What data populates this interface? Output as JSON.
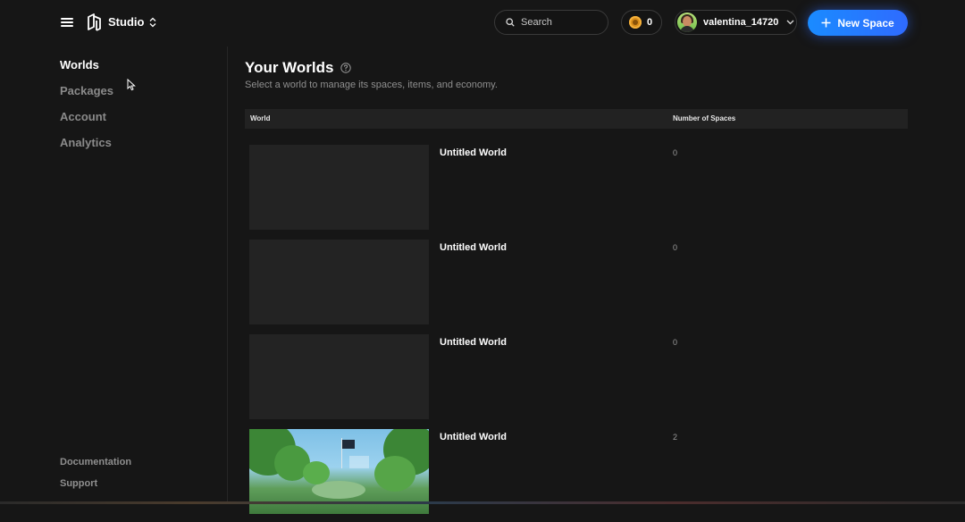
{
  "header": {
    "studio_label": "Studio",
    "search": {
      "placeholder": "Search"
    },
    "coins": "0",
    "username": "valentina_14720",
    "new_space_label": "New Space",
    "accent_color": "#1a8bff"
  },
  "sidebar": {
    "nav": [
      {
        "label": "Worlds",
        "active": true
      },
      {
        "label": "Packages",
        "active": false
      },
      {
        "label": "Account",
        "active": false
      },
      {
        "label": "Analytics",
        "active": false
      }
    ],
    "footer": [
      {
        "label": "Documentation"
      },
      {
        "label": "Support"
      }
    ]
  },
  "main": {
    "title": "Your Worlds",
    "subtitle": "Select a world to manage its spaces, items, and economy.",
    "columns": [
      "World",
      "Number of Spaces"
    ],
    "rows": [
      {
        "name": "Untitled World",
        "spaces": "0",
        "thumbnail": "blank"
      },
      {
        "name": "Untitled World",
        "spaces": "0",
        "thumbnail": "blank"
      },
      {
        "name": "Untitled World",
        "spaces": "0",
        "thumbnail": "blank"
      },
      {
        "name": "Untitled World",
        "spaces": "2",
        "thumbnail": "park-scene"
      }
    ]
  },
  "icons": [
    "menu-icon",
    "logo-icon",
    "updown-chevron-icon",
    "search-icon",
    "coin-icon",
    "avatar",
    "chevron-down-icon",
    "plus-icon",
    "help-icon",
    "cursor-icon"
  ]
}
